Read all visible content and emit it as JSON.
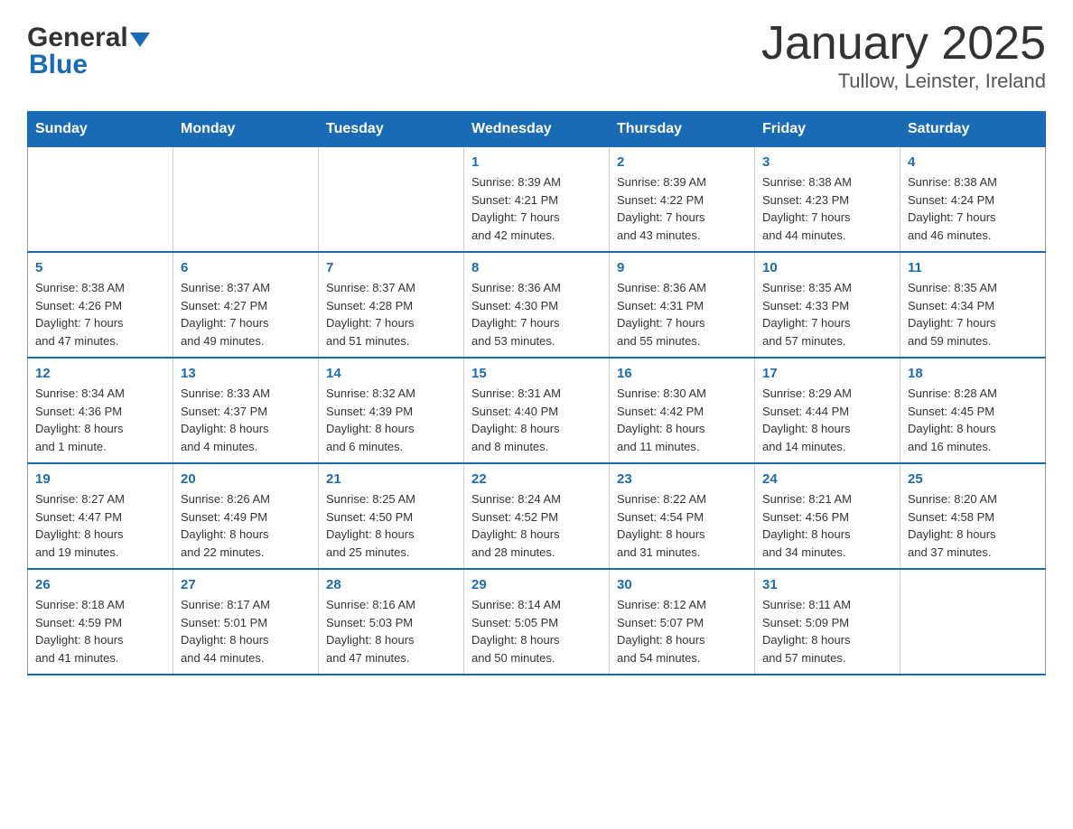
{
  "header": {
    "logo_text1": "General",
    "logo_text2": "Blue",
    "title": "January 2025",
    "subtitle": "Tullow, Leinster, Ireland"
  },
  "days_of_week": [
    "Sunday",
    "Monday",
    "Tuesday",
    "Wednesday",
    "Thursday",
    "Friday",
    "Saturday"
  ],
  "weeks": [
    [
      {
        "day": "",
        "info": ""
      },
      {
        "day": "",
        "info": ""
      },
      {
        "day": "",
        "info": ""
      },
      {
        "day": "1",
        "info": "Sunrise: 8:39 AM\nSunset: 4:21 PM\nDaylight: 7 hours\nand 42 minutes."
      },
      {
        "day": "2",
        "info": "Sunrise: 8:39 AM\nSunset: 4:22 PM\nDaylight: 7 hours\nand 43 minutes."
      },
      {
        "day": "3",
        "info": "Sunrise: 8:38 AM\nSunset: 4:23 PM\nDaylight: 7 hours\nand 44 minutes."
      },
      {
        "day": "4",
        "info": "Sunrise: 8:38 AM\nSunset: 4:24 PM\nDaylight: 7 hours\nand 46 minutes."
      }
    ],
    [
      {
        "day": "5",
        "info": "Sunrise: 8:38 AM\nSunset: 4:26 PM\nDaylight: 7 hours\nand 47 minutes."
      },
      {
        "day": "6",
        "info": "Sunrise: 8:37 AM\nSunset: 4:27 PM\nDaylight: 7 hours\nand 49 minutes."
      },
      {
        "day": "7",
        "info": "Sunrise: 8:37 AM\nSunset: 4:28 PM\nDaylight: 7 hours\nand 51 minutes."
      },
      {
        "day": "8",
        "info": "Sunrise: 8:36 AM\nSunset: 4:30 PM\nDaylight: 7 hours\nand 53 minutes."
      },
      {
        "day": "9",
        "info": "Sunrise: 8:36 AM\nSunset: 4:31 PM\nDaylight: 7 hours\nand 55 minutes."
      },
      {
        "day": "10",
        "info": "Sunrise: 8:35 AM\nSunset: 4:33 PM\nDaylight: 7 hours\nand 57 minutes."
      },
      {
        "day": "11",
        "info": "Sunrise: 8:35 AM\nSunset: 4:34 PM\nDaylight: 7 hours\nand 59 minutes."
      }
    ],
    [
      {
        "day": "12",
        "info": "Sunrise: 8:34 AM\nSunset: 4:36 PM\nDaylight: 8 hours\nand 1 minute."
      },
      {
        "day": "13",
        "info": "Sunrise: 8:33 AM\nSunset: 4:37 PM\nDaylight: 8 hours\nand 4 minutes."
      },
      {
        "day": "14",
        "info": "Sunrise: 8:32 AM\nSunset: 4:39 PM\nDaylight: 8 hours\nand 6 minutes."
      },
      {
        "day": "15",
        "info": "Sunrise: 8:31 AM\nSunset: 4:40 PM\nDaylight: 8 hours\nand 8 minutes."
      },
      {
        "day": "16",
        "info": "Sunrise: 8:30 AM\nSunset: 4:42 PM\nDaylight: 8 hours\nand 11 minutes."
      },
      {
        "day": "17",
        "info": "Sunrise: 8:29 AM\nSunset: 4:44 PM\nDaylight: 8 hours\nand 14 minutes."
      },
      {
        "day": "18",
        "info": "Sunrise: 8:28 AM\nSunset: 4:45 PM\nDaylight: 8 hours\nand 16 minutes."
      }
    ],
    [
      {
        "day": "19",
        "info": "Sunrise: 8:27 AM\nSunset: 4:47 PM\nDaylight: 8 hours\nand 19 minutes."
      },
      {
        "day": "20",
        "info": "Sunrise: 8:26 AM\nSunset: 4:49 PM\nDaylight: 8 hours\nand 22 minutes."
      },
      {
        "day": "21",
        "info": "Sunrise: 8:25 AM\nSunset: 4:50 PM\nDaylight: 8 hours\nand 25 minutes."
      },
      {
        "day": "22",
        "info": "Sunrise: 8:24 AM\nSunset: 4:52 PM\nDaylight: 8 hours\nand 28 minutes."
      },
      {
        "day": "23",
        "info": "Sunrise: 8:22 AM\nSunset: 4:54 PM\nDaylight: 8 hours\nand 31 minutes."
      },
      {
        "day": "24",
        "info": "Sunrise: 8:21 AM\nSunset: 4:56 PM\nDaylight: 8 hours\nand 34 minutes."
      },
      {
        "day": "25",
        "info": "Sunrise: 8:20 AM\nSunset: 4:58 PM\nDaylight: 8 hours\nand 37 minutes."
      }
    ],
    [
      {
        "day": "26",
        "info": "Sunrise: 8:18 AM\nSunset: 4:59 PM\nDaylight: 8 hours\nand 41 minutes."
      },
      {
        "day": "27",
        "info": "Sunrise: 8:17 AM\nSunset: 5:01 PM\nDaylight: 8 hours\nand 44 minutes."
      },
      {
        "day": "28",
        "info": "Sunrise: 8:16 AM\nSunset: 5:03 PM\nDaylight: 8 hours\nand 47 minutes."
      },
      {
        "day": "29",
        "info": "Sunrise: 8:14 AM\nSunset: 5:05 PM\nDaylight: 8 hours\nand 50 minutes."
      },
      {
        "day": "30",
        "info": "Sunrise: 8:12 AM\nSunset: 5:07 PM\nDaylight: 8 hours\nand 54 minutes."
      },
      {
        "day": "31",
        "info": "Sunrise: 8:11 AM\nSunset: 5:09 PM\nDaylight: 8 hours\nand 57 minutes."
      },
      {
        "day": "",
        "info": ""
      }
    ]
  ]
}
